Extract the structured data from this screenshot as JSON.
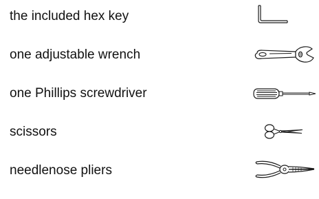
{
  "tools": [
    {
      "label": "the included hex key",
      "icon": "hex-key-icon"
    },
    {
      "label": "one adjustable wrench",
      "icon": "adjustable-wrench-icon"
    },
    {
      "label": "one Phillips screwdriver",
      "icon": "phillips-screwdriver-icon"
    },
    {
      "label": "scissors",
      "icon": "scissors-icon"
    },
    {
      "label": "needlenose pliers",
      "icon": "needlenose-pliers-icon"
    }
  ]
}
